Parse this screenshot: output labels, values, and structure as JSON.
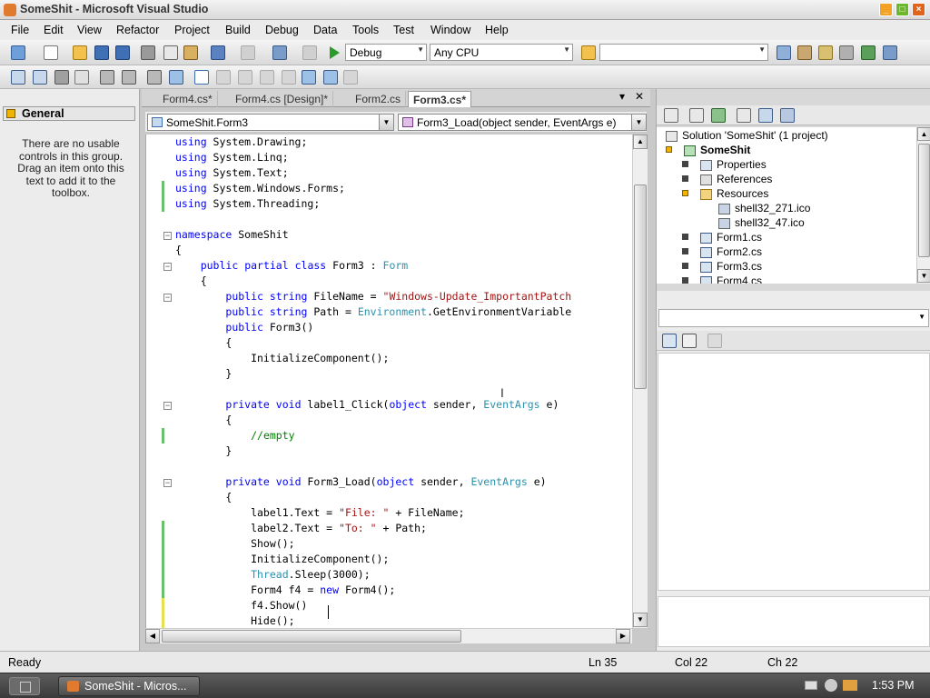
{
  "window": {
    "title": "SomeShit - Microsoft Visual Studio"
  },
  "menu": [
    "File",
    "Edit",
    "View",
    "Refactor",
    "Project",
    "Build",
    "Debug",
    "Data",
    "Tools",
    "Test",
    "Window",
    "Help"
  ],
  "toolbar": {
    "config": "Debug",
    "platform": "Any CPU",
    "find": ""
  },
  "toolbox": {
    "header": "General",
    "empty_message": "There are no usable controls in this group. Drag an item onto this text to add it to the toolbox."
  },
  "editor": {
    "tabs": [
      "Form4.cs*",
      "Form4.cs [Design]*",
      "Form2.cs",
      "Form3.cs*"
    ],
    "class_combo": "SomeShit.Form3",
    "member_combo": "Form3_Load(object sender, EventArgs e)",
    "lines": [
      "using System.Drawing;",
      "using System.Linq;",
      "using System.Text;",
      "using System.Windows.Forms;",
      "using System.Threading;",
      "",
      "namespace SomeShit",
      "{",
      "    public partial class Form3 : Form",
      "    {",
      "        public string FileName = \"Windows-Update_ImportantPatch",
      "        public string Path = Environment.GetEnvironmentVariable",
      "        public Form3()",
      "        {",
      "            InitializeComponent();",
      "        }",
      "",
      "        private void label1_Click(object sender, EventArgs e)",
      "        {",
      "            //empty",
      "        }",
      "",
      "        private void Form3_Load(object sender, EventArgs e)",
      "        {",
      "            label1.Text = \"File: \" + FileName;",
      "            label2.Text = \"To: \" + Path;",
      "            Show();",
      "            InitializeComponent();",
      "            Thread.Sleep(3000);",
      "            Form4 f4 = new Form4();",
      "            f4.Show()",
      "            Hide();"
    ]
  },
  "solution": {
    "items": [
      {
        "label": "Solution 'SomeShit' (1 project)",
        "level": 0
      },
      {
        "label": "SomeShit",
        "level": 1
      },
      {
        "label": "Properties",
        "level": 2
      },
      {
        "label": "References",
        "level": 2
      },
      {
        "label": "Resources",
        "level": 2
      },
      {
        "label": "shell32_271.ico",
        "level": 3
      },
      {
        "label": "shell32_47.ico",
        "level": 3
      },
      {
        "label": "Form1.cs",
        "level": 2
      },
      {
        "label": "Form2.cs",
        "level": 2
      },
      {
        "label": "Form3.cs",
        "level": 2
      },
      {
        "label": "Form4.cs",
        "level": 2
      }
    ]
  },
  "status": {
    "left": "Ready",
    "ln": "Ln 35",
    "col": "Col 22",
    "ch": "Ch 22"
  },
  "taskbar": {
    "task": "SomeShit - Micros...",
    "clock": "1:53 PM"
  },
  "colors": {
    "keyword": "#0000ff",
    "type": "#2b91af",
    "string": "#a31515",
    "comment": "#008000"
  }
}
